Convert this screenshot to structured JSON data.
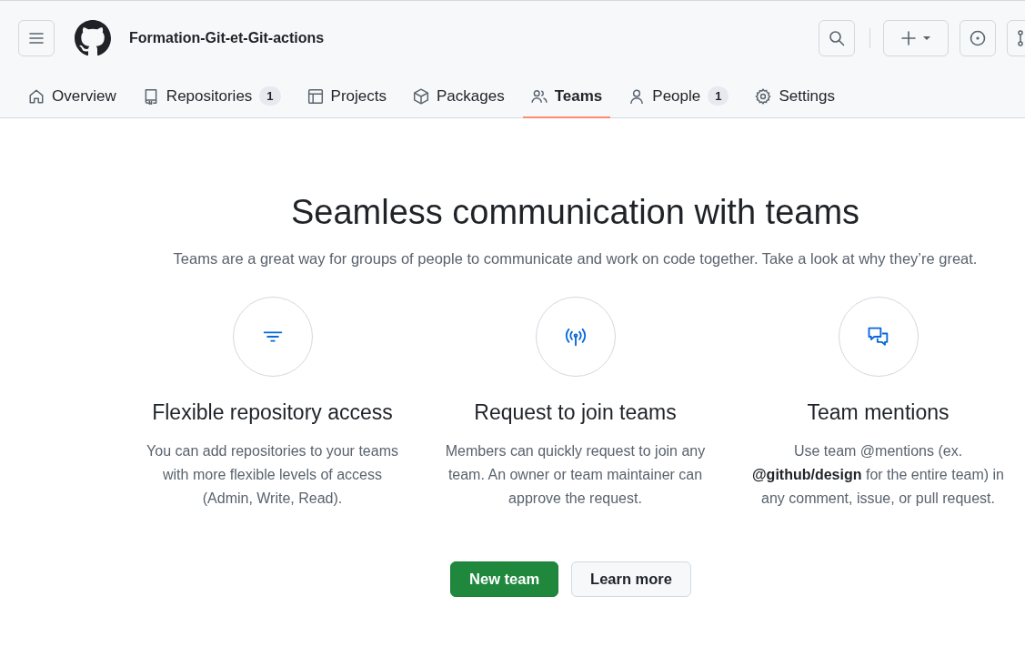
{
  "header": {
    "org_name": "Formation-Git-et-Git-actions"
  },
  "tabs": [
    {
      "label": "Overview",
      "selected": false
    },
    {
      "label": "Repositories",
      "count": "1",
      "selected": false
    },
    {
      "label": "Projects",
      "selected": false
    },
    {
      "label": "Packages",
      "selected": false
    },
    {
      "label": "Teams",
      "selected": true
    },
    {
      "label": "People",
      "count": "1",
      "selected": false
    },
    {
      "label": "Settings",
      "selected": false
    }
  ],
  "hero": {
    "title": "Seamless communication with teams",
    "subtitle": "Teams are a great way for groups of people to communicate and work on code together. Take a look at why they’re great."
  },
  "features": [
    {
      "title": "Flexible repository access",
      "text": "You can add repositories to your teams with more flexible levels of access (Admin, Write, Read)."
    },
    {
      "title": "Request to join teams",
      "text": "Members can quickly request to join any team. An owner or team maintainer can approve the request."
    },
    {
      "title": "Team mentions",
      "text": "Use team @mentions (ex. **@github/design** for the entire team) in any comment, issue, or pull request."
    }
  ],
  "actions": [
    {
      "label": "New team",
      "kind": "primary"
    },
    {
      "label": "Learn more",
      "kind": "secondary"
    }
  ]
}
